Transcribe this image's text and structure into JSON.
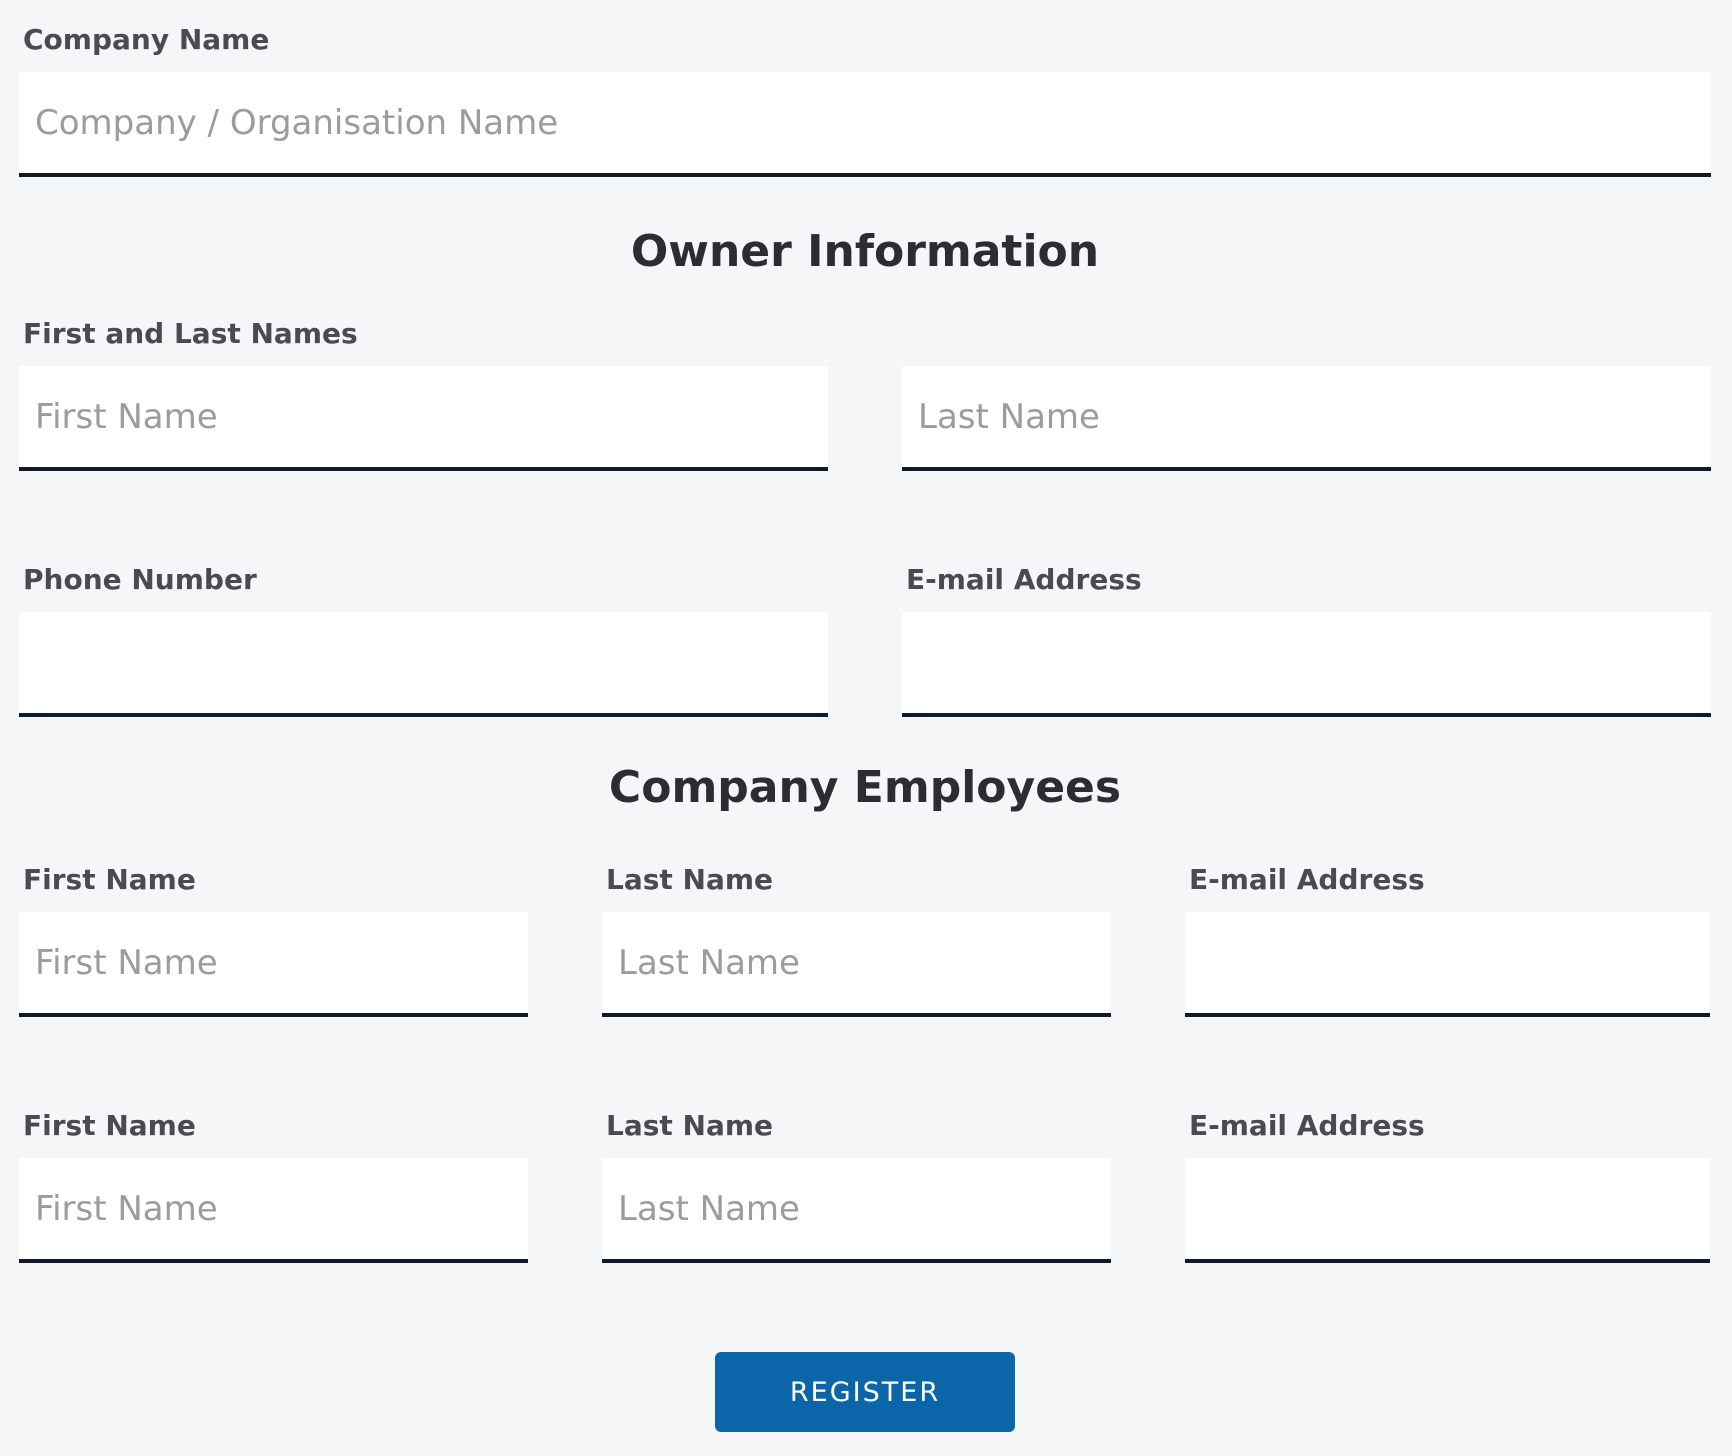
{
  "company": {
    "label": "Company Name",
    "placeholder": "Company / Organisation Name",
    "value": ""
  },
  "owner": {
    "heading": "Owner Information",
    "names_label": "First and Last Names",
    "first_name_placeholder": "First Name",
    "last_name_placeholder": "Last Name",
    "phone_label": "Phone Number",
    "email_label": "E-mail Address"
  },
  "employees": {
    "heading": "Company Employees",
    "rows": [
      {
        "first_name_label": "First Name",
        "first_name_placeholder": "First Name",
        "last_name_label": "Last Name",
        "last_name_placeholder": "Last Name",
        "email_label": "E-mail Address"
      },
      {
        "first_name_label": "First Name",
        "first_name_placeholder": "First Name",
        "last_name_label": "Last Name",
        "last_name_placeholder": "Last Name",
        "email_label": "E-mail Address"
      }
    ]
  },
  "register_label": "REGISTER",
  "colors": {
    "background": "#f5f6f8",
    "field_underline": "#111a29",
    "button": "#0a66a8",
    "button_text": "#ffffff"
  }
}
